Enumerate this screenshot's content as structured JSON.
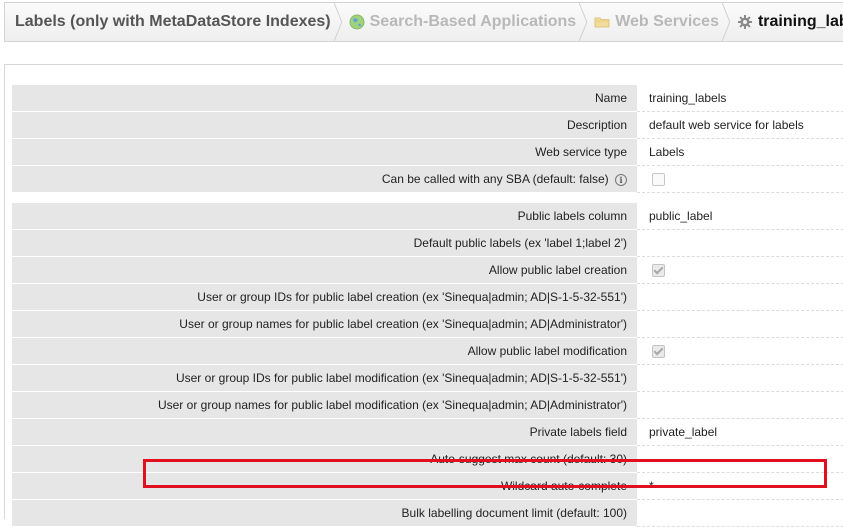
{
  "breadcrumb": {
    "items": [
      {
        "label": "Labels (only with MetaDataStore Indexes)",
        "state": "first"
      },
      {
        "label": "Search-Based Applications",
        "state": "inactive",
        "icon": "globe-icon"
      },
      {
        "label": "Web Services",
        "state": "inactive",
        "icon": "folder-icon"
      },
      {
        "label": "training_labels",
        "state": "current",
        "icon": "gear-icon"
      }
    ]
  },
  "form": {
    "rows": [
      {
        "label": "Name",
        "value": "training_labels",
        "type": "text"
      },
      {
        "label": "Description",
        "value": "default web service for labels",
        "type": "text"
      },
      {
        "label": "Web service type",
        "value": "Labels",
        "type": "text"
      },
      {
        "label": "Can be called with any SBA (default: false)",
        "value": "",
        "type": "checkbox",
        "checked": false,
        "info": true
      },
      {
        "label": "Public labels column",
        "value": "public_label",
        "type": "text"
      },
      {
        "label": "Default public labels (ex 'label 1;label 2')",
        "value": "",
        "type": "text"
      },
      {
        "label": "Allow public label creation",
        "value": "",
        "type": "checkbox",
        "checked": true
      },
      {
        "label": "User or group IDs for public label creation (ex 'Sinequa|admin; AD|S-1-5-32-551')",
        "value": "",
        "type": "text"
      },
      {
        "label": "User or group names for public label creation (ex 'Sinequa|admin; AD|Administrator')",
        "value": "",
        "type": "text"
      },
      {
        "label": "Allow public label modification",
        "value": "",
        "type": "checkbox",
        "checked": true
      },
      {
        "label": "User or group IDs for public label modification (ex 'Sinequa|admin; AD|S-1-5-32-551')",
        "value": "",
        "type": "text"
      },
      {
        "label": "User or group names for public label modification (ex 'Sinequa|admin; AD|Administrator')",
        "value": "",
        "type": "text"
      },
      {
        "label": "Private labels field",
        "value": "private_label",
        "type": "text"
      },
      {
        "label": "Auto-suggest max count (default: 30)",
        "value": "",
        "type": "text"
      },
      {
        "label": "Wildcard auto-complete",
        "value": "*",
        "type": "text"
      },
      {
        "label": "Bulk labelling document limit (default: 100)",
        "value": "",
        "type": "text"
      }
    ]
  },
  "colors": {
    "highlight": "#e0101e",
    "label_bg": "#e6e6e6"
  }
}
